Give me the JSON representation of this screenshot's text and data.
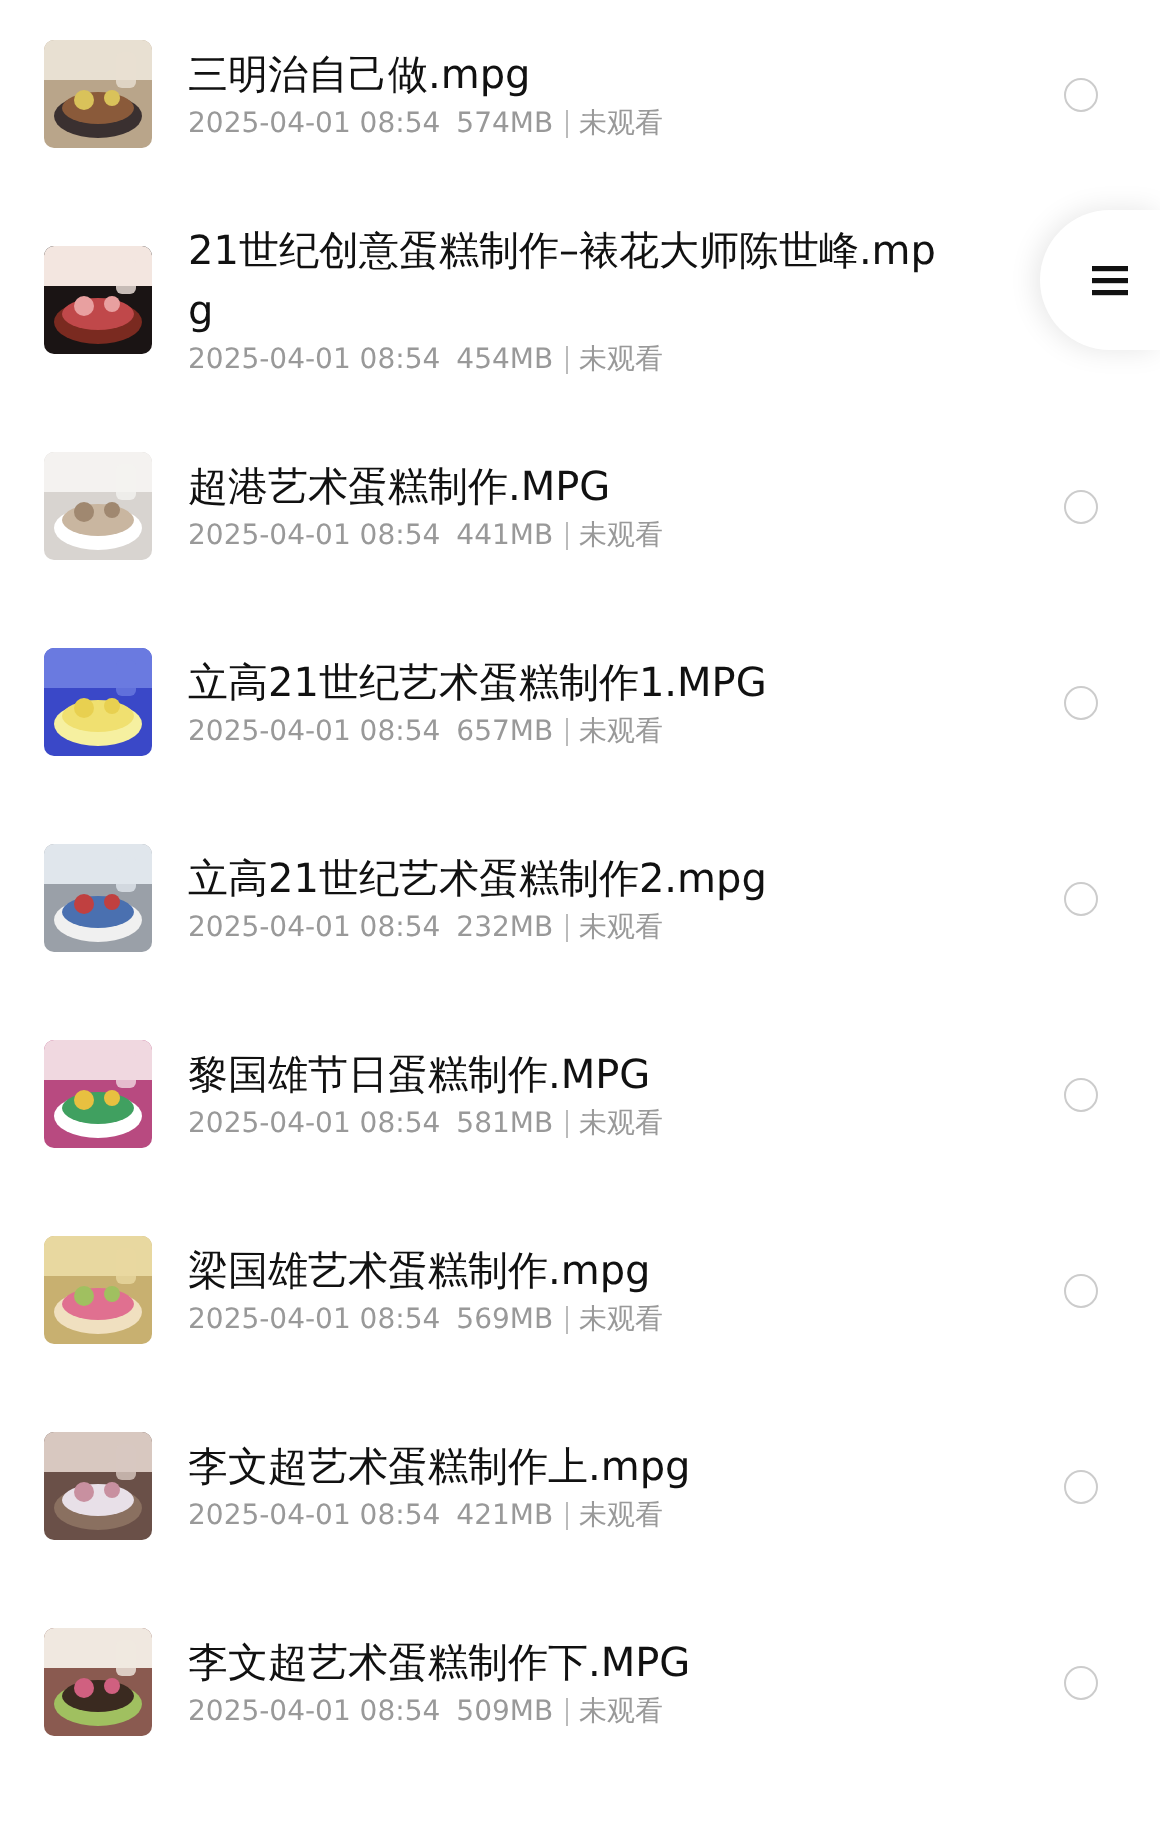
{
  "files": [
    {
      "title": "三明治自己做.mpg",
      "date": "2025-04-01 08:54",
      "size": "574MB",
      "status": "未观看",
      "selected": false
    },
    {
      "title": "21世纪创意蛋糕制作–裱花大师陈世峰.mpg",
      "date": "2025-04-01 08:54",
      "size": "454MB",
      "status": "未观看"
    },
    {
      "title": "超港艺术蛋糕制作.MPG",
      "date": "2025-04-01 08:54",
      "size": "441MB",
      "status": "未观看",
      "selected": false
    },
    {
      "title": "立高21世纪艺术蛋糕制作1.MPG",
      "date": "2025-04-01 08:54",
      "size": "657MB",
      "status": "未观看",
      "selected": false
    },
    {
      "title": "立高21世纪艺术蛋糕制作2.mpg",
      "date": "2025-04-01 08:54",
      "size": "232MB",
      "status": "未观看",
      "selected": false
    },
    {
      "title": "黎国雄节日蛋糕制作.MPG",
      "date": "2025-04-01 08:54",
      "size": "581MB",
      "status": "未观看",
      "selected": false
    },
    {
      "title": "梁国雄艺术蛋糕制作.mpg",
      "date": "2025-04-01 08:54",
      "size": "569MB",
      "status": "未观看",
      "selected": false
    },
    {
      "title": "李文超艺术蛋糕制作上.mpg",
      "date": "2025-04-01 08:54",
      "size": "421MB",
      "status": "未观看",
      "selected": false
    },
    {
      "title": "李文超艺术蛋糕制作下.MPG",
      "date": "2025-04-01 08:54",
      "size": "509MB",
      "status": "未观看",
      "selected": false
    }
  ],
  "floating_menu": {
    "visible": true
  }
}
